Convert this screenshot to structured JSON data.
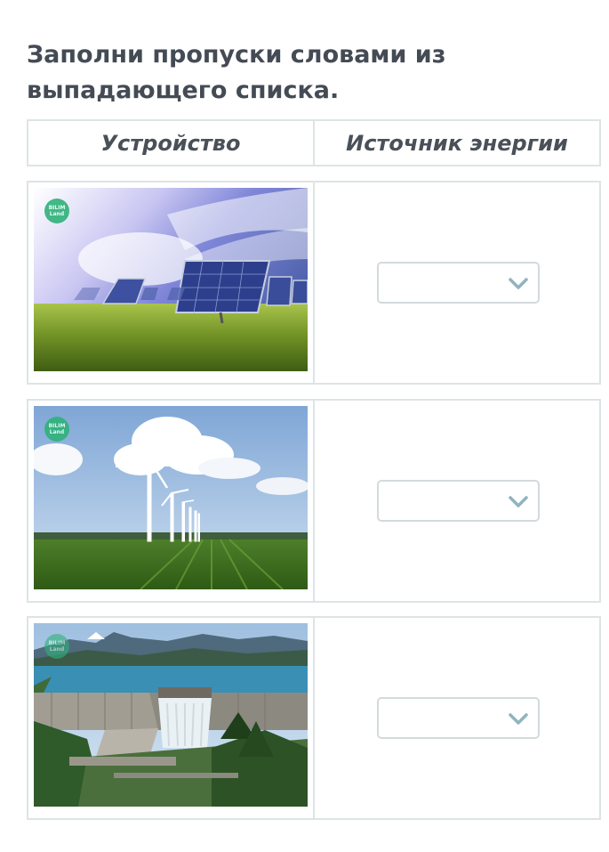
{
  "task": {
    "title": "Заполни пропуски словами из выпадающего списка."
  },
  "table": {
    "headers": [
      "Устройство",
      "Источник энергии"
    ],
    "rows": [
      {
        "image": "solar-panels-photo",
        "selected": ""
      },
      {
        "image": "wind-turbines-photo",
        "selected": ""
      },
      {
        "image": "hydro-dam-photo",
        "selected": ""
      }
    ]
  },
  "watermark": {
    "text": "BILIM Land"
  },
  "colors": {
    "border": "#dde4e6",
    "select_border": "#d3dadd",
    "chevron": "#8fb4bd",
    "badge": "#2fb27a"
  }
}
